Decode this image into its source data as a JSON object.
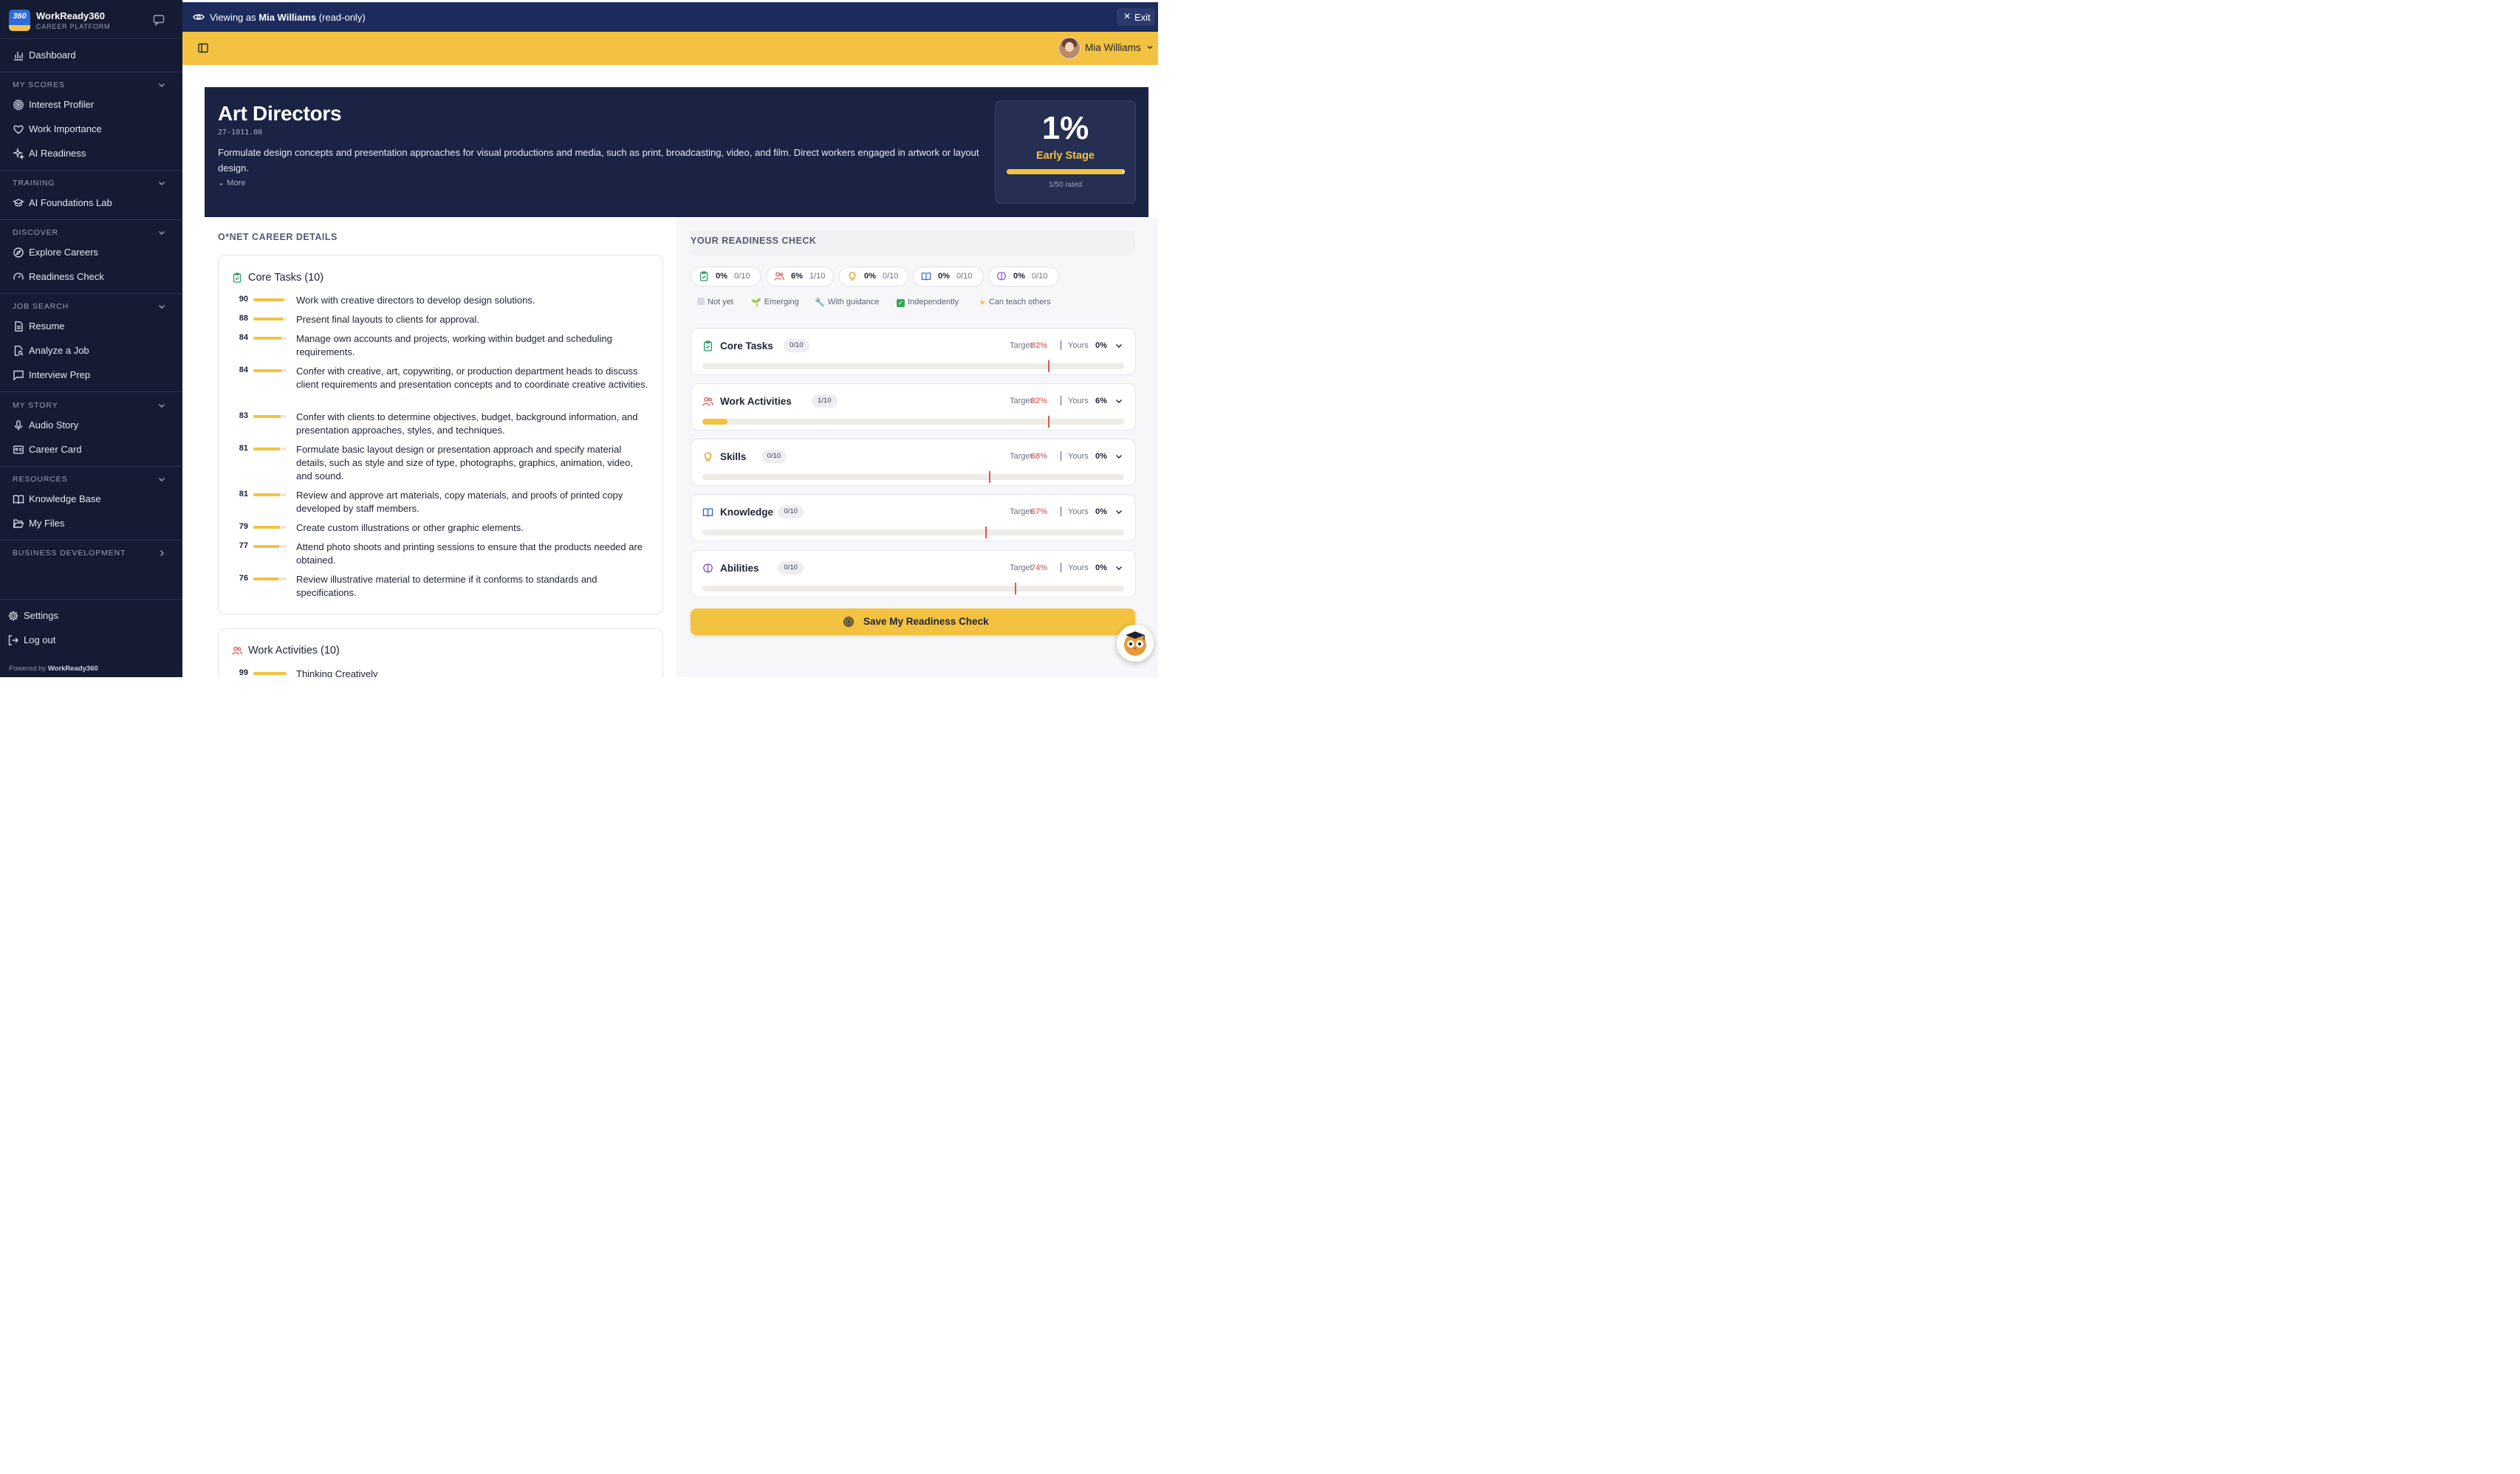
{
  "app": {
    "brand_name": "WorkReady360",
    "brand_sub": "CAREER PLATFORM",
    "logo_text": "360"
  },
  "sidebar": {
    "dashboard": "Dashboard",
    "sections": [
      {
        "label": "MY SCORES",
        "items": [
          "Interest Profiler",
          "Work Importance",
          "AI Readiness"
        ]
      },
      {
        "label": "TRAINING",
        "items": [
          "AI Foundations Lab"
        ]
      },
      {
        "label": "DISCOVER",
        "items": [
          "Explore Careers",
          "Readiness Check"
        ]
      },
      {
        "label": "JOB SEARCH",
        "items": [
          "Resume",
          "Analyze a Job",
          "Interview Prep"
        ]
      },
      {
        "label": "MY STORY",
        "items": [
          "Audio Story",
          "Career Card"
        ]
      },
      {
        "label": "RESOURCES",
        "items": [
          "Knowledge Base",
          "My Files"
        ]
      },
      {
        "label": "BUSINESS DEVELOPMENT",
        "items": []
      }
    ],
    "settings": "Settings",
    "logout": "Log out",
    "powered_prefix": "Powered by",
    "powered_brand": "WorkReady360"
  },
  "viewbar": {
    "prefix": "Viewing as",
    "user": "Mia Williams",
    "suffix": "(read-only)",
    "exit": "Exit"
  },
  "userbar": {
    "user_name": "Mia Williams"
  },
  "hero": {
    "title": "Art Directors",
    "code": "27-1011.00",
    "description": "Formulate design concepts and presentation approaches for visual productions and media, such as print, broadcasting, video, and film. Direct workers engaged in artwork or layout design.",
    "more": "More",
    "score": "1%",
    "stage": "Early Stage",
    "progress": 0.98,
    "rated": "1/50 rated"
  },
  "left": {
    "section_title": "O*NET CAREER DETAILS",
    "core_tasks_title": "Core Tasks (10)",
    "tasks": [
      {
        "score": 90,
        "text": "Work with creative directors to develop design solutions."
      },
      {
        "score": 88,
        "text": "Present final layouts to clients for approval."
      },
      {
        "score": 84,
        "text": "Manage own accounts and projects, working within budget and scheduling requirements."
      },
      {
        "score": 84,
        "text": "Confer with creative, art, copywriting, or production department heads to discuss client requirements and presentation concepts and to coordinate creative activities."
      },
      {
        "score": 83,
        "text": "Confer with clients to determine objectives, budget, background information, and presentation approaches, styles, and techniques."
      },
      {
        "score": 81,
        "text": "Formulate basic layout design or presentation approach and specify material details, such as style and size of type, photographs, graphics, animation, video, and sound."
      },
      {
        "score": 81,
        "text": "Review and approve art materials, copy materials, and proofs of printed copy developed by staff members."
      },
      {
        "score": 79,
        "text": "Create custom illustrations or other graphic elements."
      },
      {
        "score": 77,
        "text": "Attend photo shoots and printing sessions to ensure that the products needed are obtained."
      },
      {
        "score": 76,
        "text": "Review illustrative material to determine if it conforms to standards and specifications."
      }
    ],
    "work_activities_title": "Work Activities (10)",
    "activities": [
      {
        "score": 99,
        "text": "Thinking Creatively"
      }
    ]
  },
  "right": {
    "section_title": "YOUR READINESS CHECK",
    "chips": [
      {
        "pct": "0%",
        "frac": "0/10",
        "icon": "clipboard-icon",
        "color": "#2e9e6a"
      },
      {
        "pct": "6%",
        "frac": "1/10",
        "icon": "people-icon",
        "color": "#e05a5a"
      },
      {
        "pct": "0%",
        "frac": "0/10",
        "icon": "lightbulb-icon",
        "color": "#e0a020"
      },
      {
        "pct": "0%",
        "frac": "0/10",
        "icon": "book-icon",
        "color": "#3b6fd6"
      },
      {
        "pct": "0%",
        "frac": "0/10",
        "icon": "brain-icon",
        "color": "#8a4fd0"
      }
    ],
    "legend": [
      "Not yet",
      "Emerging",
      "With guidance",
      "Independently",
      "Can teach others"
    ],
    "target_label": "Target",
    "yours_label": "Yours",
    "categories": [
      {
        "name": "Core Tasks",
        "badge": "0/10",
        "target": "82%",
        "yours": "0%",
        "target_value": 82,
        "yours_value": 0,
        "icon": "clipboard-icon",
        "color": "#2e9e6a"
      },
      {
        "name": "Work Activities",
        "badge": "1/10",
        "target": "82%",
        "yours": "6%",
        "target_value": 82,
        "yours_value": 6,
        "icon": "people-icon",
        "color": "#e05a5a"
      },
      {
        "name": "Skills",
        "badge": "0/10",
        "target": "68%",
        "yours": "0%",
        "target_value": 68,
        "yours_value": 0,
        "icon": "lightbulb-icon",
        "color": "#e0a020"
      },
      {
        "name": "Knowledge",
        "badge": "0/10",
        "target": "67%",
        "yours": "0%",
        "target_value": 67,
        "yours_value": 0,
        "icon": "book-icon",
        "color": "#3b6fd6"
      },
      {
        "name": "Abilities",
        "badge": "0/10",
        "target": "74%",
        "yours": "0%",
        "target_value": 74,
        "yours_value": 0,
        "icon": "brain-icon",
        "color": "#8a4fd0"
      }
    ],
    "save_label": "Save My Readiness Check"
  },
  "colors": {
    "sidebar_bg": "#141b33",
    "accent_yellow": "#f2c240",
    "hero_bg": "#1a2344",
    "viewbar_bg": "#1d2a5c",
    "target_red": "#e05555"
  }
}
